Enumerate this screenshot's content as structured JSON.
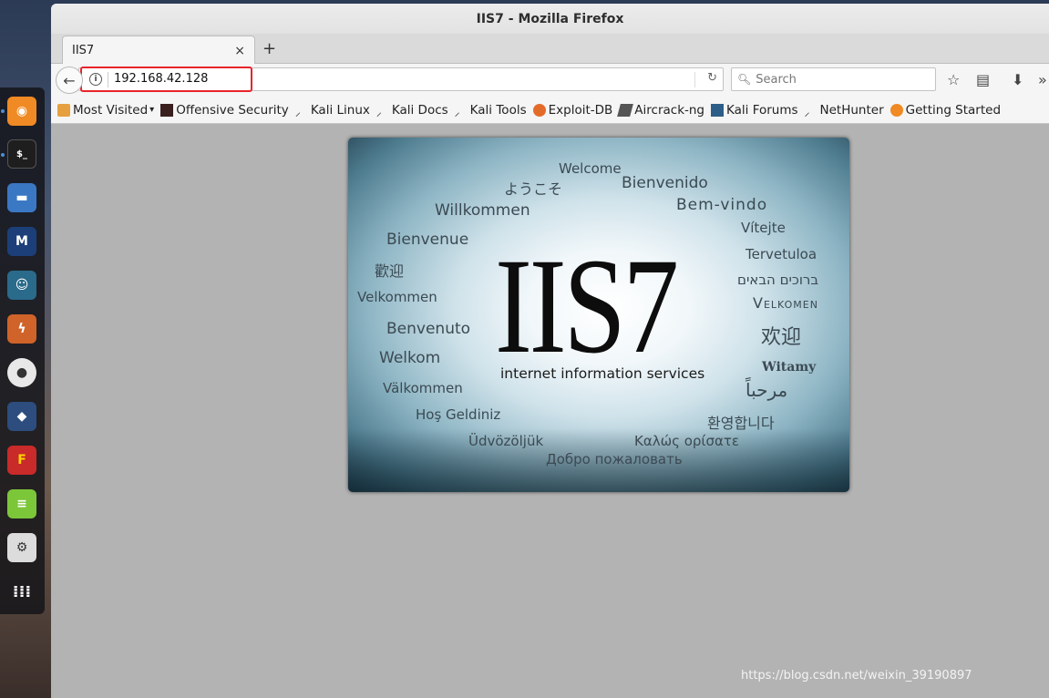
{
  "window": {
    "title": "IIS7 - Mozilla Firefox"
  },
  "tab": {
    "label": "IIS7",
    "close": "×",
    "new_tab": "+"
  },
  "navbar": {
    "url": "192.168.42.128",
    "search_placeholder": "Search"
  },
  "bookmarks": [
    {
      "label": "Most Visited",
      "icon": "most-visited-icon"
    },
    {
      "label": "Offensive Security",
      "icon": "offsec-icon"
    },
    {
      "label": "Kali Linux",
      "icon": "kali-icon"
    },
    {
      "label": "Kali Docs",
      "icon": "kali-icon"
    },
    {
      "label": "Kali Tools",
      "icon": "kali-icon"
    },
    {
      "label": "Exploit-DB",
      "icon": "exploitdb-icon"
    },
    {
      "label": "Aircrack-ng",
      "icon": "aircrack-icon"
    },
    {
      "label": "Kali Forums",
      "icon": "forums-icon"
    },
    {
      "label": "NetHunter",
      "icon": "kali-icon"
    },
    {
      "label": "Getting Started",
      "icon": "firefox-icon"
    }
  ],
  "iis": {
    "logo": "IIS7",
    "subtitle": "internet information services",
    "words": {
      "welcome": "Welcome",
      "yokoso": "ようこそ",
      "bienvenido": "Bienvenido",
      "willkommen": "Willkommen",
      "bemvindo": "Bem-vindo",
      "vitejte": "Vítejte",
      "bienvenue": "Bienvenue",
      "tervetuloa": "Tervetuloa",
      "huanying_trad": "歡迎",
      "hebrew": "ברוכים הבאים",
      "velkommen": "Velkommen",
      "velkomen": "Velkomen",
      "benvenuto": "Benvenuto",
      "huanying": "欢迎",
      "welkom": "Welkom",
      "witamy": "Witamy",
      "valkommen": "Välkommen",
      "arabic": "مرحباً",
      "hosgeldiniz": "Hoş Geldiniz",
      "korean": "환영합니다",
      "udvozoljuk": "Üdvözöljük",
      "greek": "Καλώς ορίσατε",
      "russian": "Добро пожаловать"
    }
  },
  "watermark": "https://blog.csdn.net/weixin_39190897"
}
